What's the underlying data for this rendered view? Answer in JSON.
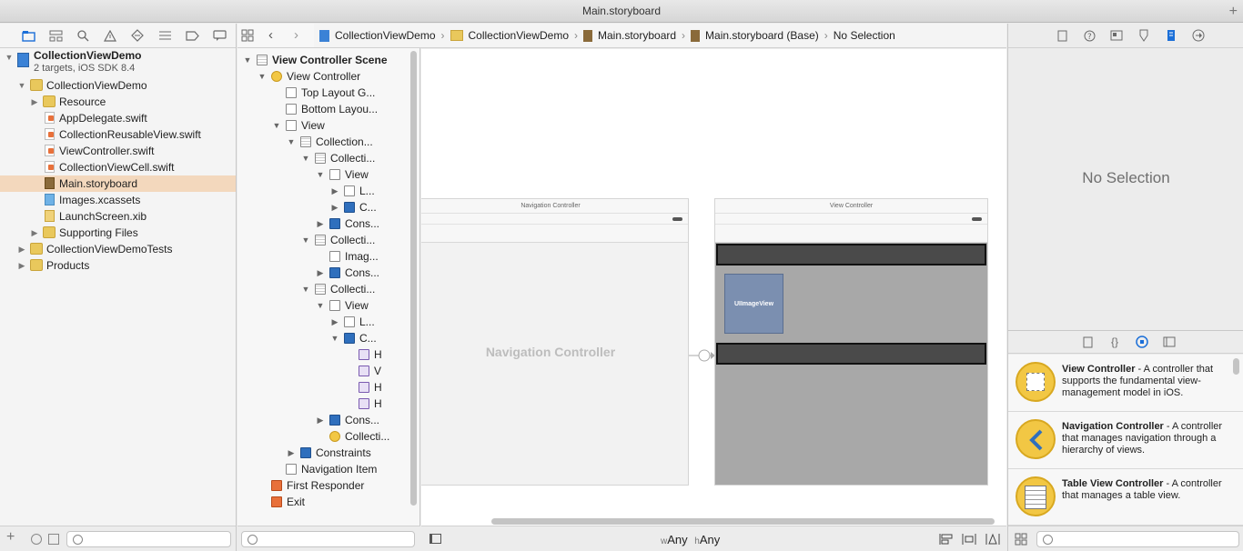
{
  "window": {
    "title": "Main.storyboard"
  },
  "navigator": {
    "toolbar_icons": [
      "folder-icon",
      "hierarchy-icon",
      "search-icon",
      "warning-icon",
      "test-icon",
      "debug-icon",
      "breakpoint-icon",
      "log-icon"
    ],
    "project": {
      "name": "CollectionViewDemo",
      "subtitle": "2 targets, iOS SDK 8.4"
    },
    "items": [
      {
        "label": "CollectionViewDemo",
        "type": "folder",
        "indent": 1,
        "disclosure": "open"
      },
      {
        "label": "Resource",
        "type": "folder",
        "indent": 2,
        "disclosure": "closed"
      },
      {
        "label": "AppDelegate.swift",
        "type": "swift",
        "indent": 2
      },
      {
        "label": "CollectionReusableView.swift",
        "type": "swift",
        "indent": 2
      },
      {
        "label": "ViewController.swift",
        "type": "swift",
        "indent": 2
      },
      {
        "label": "CollectionViewCell.swift",
        "type": "swift",
        "indent": 2
      },
      {
        "label": "Main.storyboard",
        "type": "story",
        "indent": 2,
        "selected": true
      },
      {
        "label": "Images.xcassets",
        "type": "assets",
        "indent": 2
      },
      {
        "label": "LaunchScreen.xib",
        "type": "xib",
        "indent": 2
      },
      {
        "label": "Supporting Files",
        "type": "folder",
        "indent": 2,
        "disclosure": "closed"
      },
      {
        "label": "CollectionViewDemoTests",
        "type": "folder",
        "indent": 1,
        "disclosure": "closed"
      },
      {
        "label": "Products",
        "type": "folder",
        "indent": 1,
        "disclosure": "closed"
      }
    ]
  },
  "jumpbar": {
    "crumbs": [
      "CollectionViewDemo",
      "CollectionViewDemo",
      "Main.storyboard",
      "Main.storyboard (Base)",
      "No Selection"
    ]
  },
  "outline": {
    "rows": [
      {
        "label": "View Controller Scene",
        "depth": 0,
        "disc": "open",
        "icon": "grid",
        "bold": true
      },
      {
        "label": "View Controller",
        "depth": 1,
        "disc": "open",
        "icon": "yellow"
      },
      {
        "label": "Top Layout G...",
        "depth": 2,
        "icon": "plain"
      },
      {
        "label": "Bottom Layou...",
        "depth": 2,
        "icon": "plain"
      },
      {
        "label": "View",
        "depth": 2,
        "disc": "open",
        "icon": "plain"
      },
      {
        "label": "Collection...",
        "depth": 3,
        "disc": "open",
        "icon": "grid"
      },
      {
        "label": "Collecti...",
        "depth": 4,
        "disc": "open",
        "icon": "grid"
      },
      {
        "label": "View",
        "depth": 5,
        "disc": "open",
        "icon": "plain"
      },
      {
        "label": "L...",
        "depth": 6,
        "disc": "closed",
        "icon": "plain"
      },
      {
        "label": "C...",
        "depth": 6,
        "disc": "closed",
        "icon": "blue"
      },
      {
        "label": "Cons...",
        "depth": 5,
        "disc": "closed",
        "icon": "blue"
      },
      {
        "label": "Collecti...",
        "depth": 4,
        "disc": "open",
        "icon": "grid"
      },
      {
        "label": "Imag...",
        "depth": 5,
        "icon": "plain"
      },
      {
        "label": "Cons...",
        "depth": 5,
        "disc": "closed",
        "icon": "blue"
      },
      {
        "label": "Collecti...",
        "depth": 4,
        "disc": "open",
        "icon": "grid"
      },
      {
        "label": "View",
        "depth": 5,
        "disc": "open",
        "icon": "plain"
      },
      {
        "label": "L...",
        "depth": 6,
        "disc": "closed",
        "icon": "plain"
      },
      {
        "label": "C...",
        "depth": 6,
        "disc": "open",
        "icon": "blue"
      },
      {
        "label": "H",
        "depth": 7,
        "icon": "purple"
      },
      {
        "label": "V",
        "depth": 7,
        "icon": "purple"
      },
      {
        "label": "H",
        "depth": 7,
        "icon": "purple"
      },
      {
        "label": "H",
        "depth": 7,
        "icon": "purple"
      },
      {
        "label": "Cons...",
        "depth": 5,
        "disc": "closed",
        "icon": "blue"
      },
      {
        "label": "Collecti...",
        "depth": 5,
        "icon": "yellow"
      },
      {
        "label": "Constraints",
        "depth": 3,
        "disc": "closed",
        "icon": "blue"
      },
      {
        "label": "Navigation Item",
        "depth": 2,
        "icon": "plain"
      },
      {
        "label": "First Responder",
        "depth": 1,
        "icon": "orange"
      },
      {
        "label": "Exit",
        "depth": 1,
        "icon": "orange"
      }
    ]
  },
  "canvas": {
    "nav_scene": {
      "title": "Navigation Controller",
      "placeholder": "Navigation Controller"
    },
    "vc_scene": {
      "title": "View Controller",
      "image_view_label": "UIImageView"
    }
  },
  "editor_bottom": {
    "w_label": "w",
    "w_value": "Any",
    "h_label": "h",
    "h_value": "Any"
  },
  "inspector": {
    "toolbar_icons": [
      "file-icon",
      "help-icon",
      "identity-icon",
      "attributes-icon",
      "size-icon",
      "connections-icon"
    ],
    "no_selection": "No Selection",
    "library_toolbar_icons": [
      "file-template-icon",
      "code-snippet-icon",
      "object-library-icon",
      "media-library-icon"
    ],
    "library": [
      {
        "title": "View Controller",
        "desc": " - A controller that supports the fundamental view-management model in iOS."
      },
      {
        "title": "Navigation Controller",
        "desc": " - A controller that manages navigation through a hierarchy of views."
      },
      {
        "title": "Table View Controller",
        "desc": " - A controller that manages a table view."
      }
    ]
  },
  "colors": {
    "accent": "#1b6fd8",
    "selection": "#f3d8bd",
    "scene_dark": "#4a4a4a"
  }
}
